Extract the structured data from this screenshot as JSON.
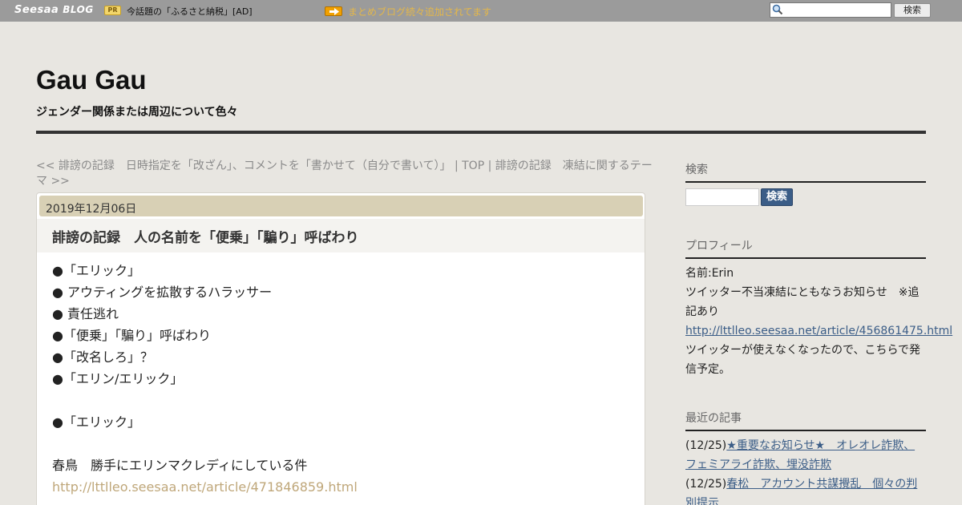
{
  "topbar": {
    "logo_main": "Seesaa",
    "logo_sub": "BLOG",
    "pr_badge": "PR",
    "pr_text": "今話題の「ふるさと納税」[AD]",
    "ticker": "まとめブログ続々追加されてます",
    "search_placeholder": "",
    "search_button": "検索"
  },
  "header": {
    "title": "Gau Gau",
    "description": "ジェンダー関係または周辺について色々"
  },
  "topic_nav": {
    "prev": "<< 誹謗の記録　日時指定を「改ざん」、コメントを「書かせて（自分で書いて）」",
    "sep1": " | ",
    "top": "TOP",
    "sep2": " | ",
    "next": "誹謗の記録　凍結に関するテーマ >>"
  },
  "entry": {
    "date": "2019年12月06日",
    "title": "誹謗の記録　人の名前を「便乗」「騙り」呼ばわり",
    "lines": [
      "●「エリック」",
      "● アウティングを拡散するハラッサー",
      "● 責任逃れ",
      "●「便乗」「騙り」呼ばわり",
      "●「改名しろ」？",
      "●「エリン/エリック」",
      "",
      "●「エリック」",
      "",
      "春鳥　勝手にエリンマクレディにしている件"
    ],
    "link": "http://lttlleo.seesaa.net/article/471846859.html"
  },
  "sidebar": {
    "search_heading": "検索",
    "search_button": "検索",
    "profile_heading": "プロフィール",
    "profile_name": "名前:Erin",
    "profile_notice": "ツイッター不当凍結にともなうお知らせ　※追記あり",
    "profile_link": "http://lttlleo.seesaa.net/article/456861475.html",
    "profile_note": "ツイッターが使えなくなったので、こちらで発信予定。",
    "recent_heading": "最近の記事",
    "recent": [
      {
        "date": "(12/25)",
        "title": "★重要なお知らせ★　オレオレ詐欺、フェミアライ詐欺、埋没詐欺"
      },
      {
        "date": "(12/25)",
        "title": "春松　アカウント共謀攪乱　個々の判別提示"
      }
    ]
  },
  "colors": {
    "page_bg": "#e8e6e1",
    "topbar_bg": "#9b9b9b",
    "date_band": "#d8d0b5",
    "link_blue": "#3b5d87",
    "entry_link": "#bfa77a"
  }
}
